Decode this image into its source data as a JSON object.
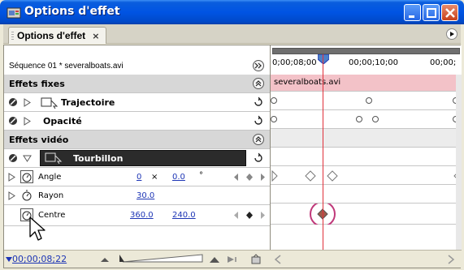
{
  "window": {
    "title": "Options d'effet"
  },
  "panel_tab": {
    "label": "Options d'effet",
    "close": "×"
  },
  "sequence": {
    "label": "Séquence 01 * severalboats.avi"
  },
  "ruler": {
    "tc_left": "0;00;08;00",
    "tc_mid": "00;00;10;00",
    "tc_right": "00;00;"
  },
  "clip": {
    "name": "severalboats.avi"
  },
  "sections": {
    "fixed": "Effets fixes",
    "video": "Effets vidéo"
  },
  "effects": {
    "trajectoire": "Trajectoire",
    "opacite": "Opacité",
    "tourbillon": "Tourbillon"
  },
  "params": {
    "angle": {
      "label": "Angle",
      "v1": "0",
      "sep": "×",
      "v2": "0.0",
      "unit": "°"
    },
    "rayon": {
      "label": "Rayon",
      "v1": "30.0"
    },
    "centre": {
      "label": "Centre",
      "v1": "360.0",
      "v2": "240.0"
    }
  },
  "footer": {
    "timecode": "00;00;08;22"
  },
  "colors": {
    "accent": "#1d35b5",
    "playhead": "#e0303a",
    "clip": "#f3c2c8",
    "highlight_ring": "#c0397a"
  }
}
